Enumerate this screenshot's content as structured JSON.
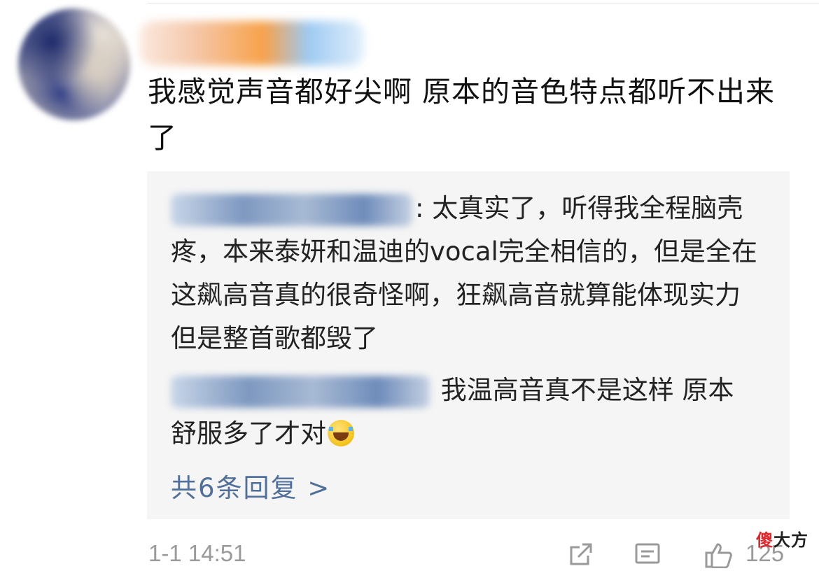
{
  "comment": {
    "text": "我感觉声音都好尖啊 原本的音色特点都听不出来了",
    "timestamp": "1-1 14:51",
    "like_count": "125"
  },
  "replies": [
    {
      "text": ": 太真实了，听得我全程脑壳疼，本来泰妍和温迪的vocal完全相信的，但是全在这飙高音真的很奇怪啊，狂飙高音就算能体现实力但是整首歌都毁了"
    },
    {
      "text": " 我温高音真不是这样 原本舒服多了才对",
      "emoji": "laughing-tears-emoji"
    }
  ],
  "more_replies_label": "共6条回复 >",
  "icons": {
    "share": "share-icon",
    "comment": "comment-icon",
    "like": "thumbs-up-icon"
  },
  "watermark": {
    "accent": "傻",
    "rest": "大方"
  }
}
